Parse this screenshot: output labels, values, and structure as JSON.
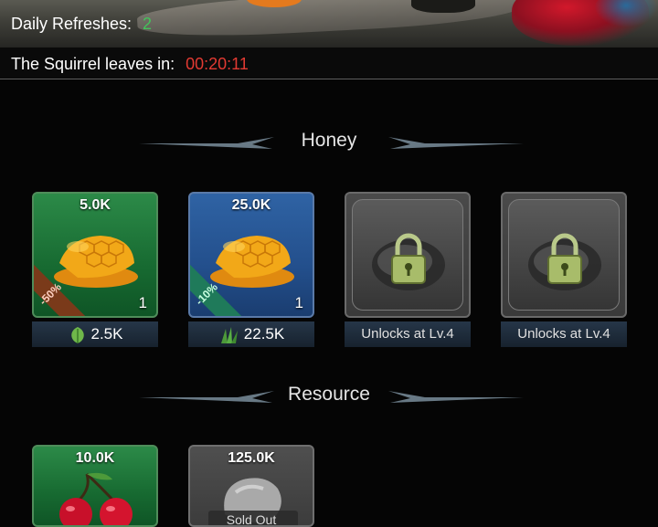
{
  "header": {
    "daily_refreshes_label": "Daily Refreshes:",
    "daily_refreshes_value": "2",
    "leave_label": "The Squirrel leaves in:",
    "leave_timer": "00:20:11"
  },
  "sections": [
    {
      "title": "Honey",
      "items": [
        {
          "amount": "5.0K",
          "count": "1",
          "discount": "-50%",
          "price": "2.5K",
          "price_icon": "leaf-icon",
          "state": "available",
          "color": "#1f7a3a"
        },
        {
          "amount": "25.0K",
          "count": "1",
          "discount": "-10%",
          "price": "22.5K",
          "price_icon": "grass-icon",
          "state": "available",
          "color": "#2a5a99"
        },
        {
          "amount": "",
          "state": "locked",
          "price": "Unlocks at Lv.4",
          "icon": "padlock-icon"
        },
        {
          "amount": "",
          "state": "locked",
          "price": "Unlocks at Lv.4",
          "icon": "padlock-icon"
        }
      ]
    },
    {
      "title": "Resource",
      "items": [
        {
          "amount": "10.0K",
          "icon": "cherry-icon",
          "state": "available",
          "color": "#1f7a3a"
        },
        {
          "amount": "125.0K",
          "icon": "stone-icon",
          "state": "sold-out",
          "status": "Sold Out"
        }
      ]
    }
  ]
}
